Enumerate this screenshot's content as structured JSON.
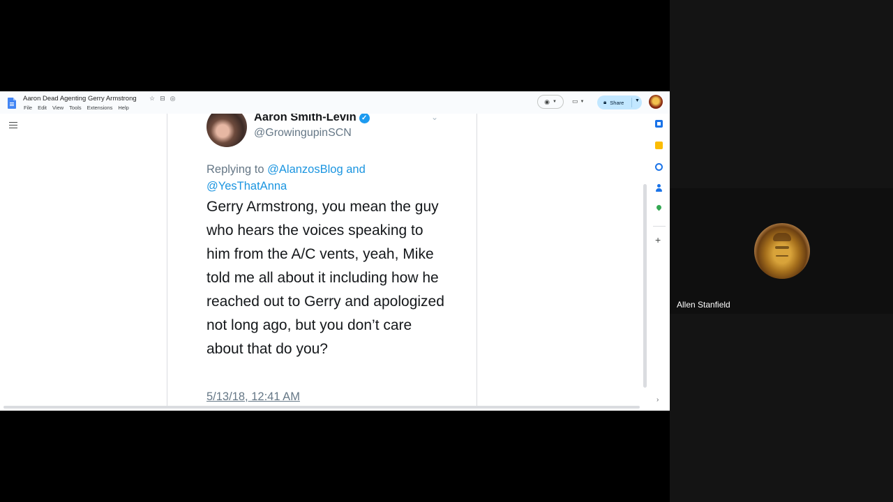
{
  "docs": {
    "title": "Aaron Dead Agenting Gerry Armstrong",
    "menu": [
      "File",
      "Edit",
      "View",
      "Tools",
      "Extensions",
      "Help"
    ],
    "share_label": "Share"
  },
  "tweet": {
    "name": "Aaron Smith-Levin",
    "handle": "@GrowingupinSCN",
    "reply_prefix": "Replying to",
    "reply_link_1": "@AlanzosBlog",
    "reply_and": "and",
    "reply_link_2": "@YesThatAnna",
    "text": "Gerry Armstrong, you mean the guy who hears the voices speaking to him from the A/C vents, yeah, Mike told me all about it including how he reached out to Gerry and apologized not long ago, but you don’t care about that do you?",
    "date": "5/13/18, 12:41 AM"
  },
  "participant": {
    "name": "Allen Stanfield"
  },
  "icons": [
    "docs-logo-icon",
    "star-icon",
    "move-folder-icon",
    "status-icon",
    "eye-icon",
    "video-call-icon",
    "lock-icon",
    "outline-icon",
    "calendar-icon",
    "keep-icon",
    "tasks-icon",
    "contacts-icon",
    "maps-icon",
    "plus-icon",
    "chevron-right-icon",
    "verified-badge-icon"
  ],
  "colors": {
    "share_button": "#c2e7ff",
    "twitter_link": "#1b95e0",
    "verified": "#1d9bf0"
  }
}
